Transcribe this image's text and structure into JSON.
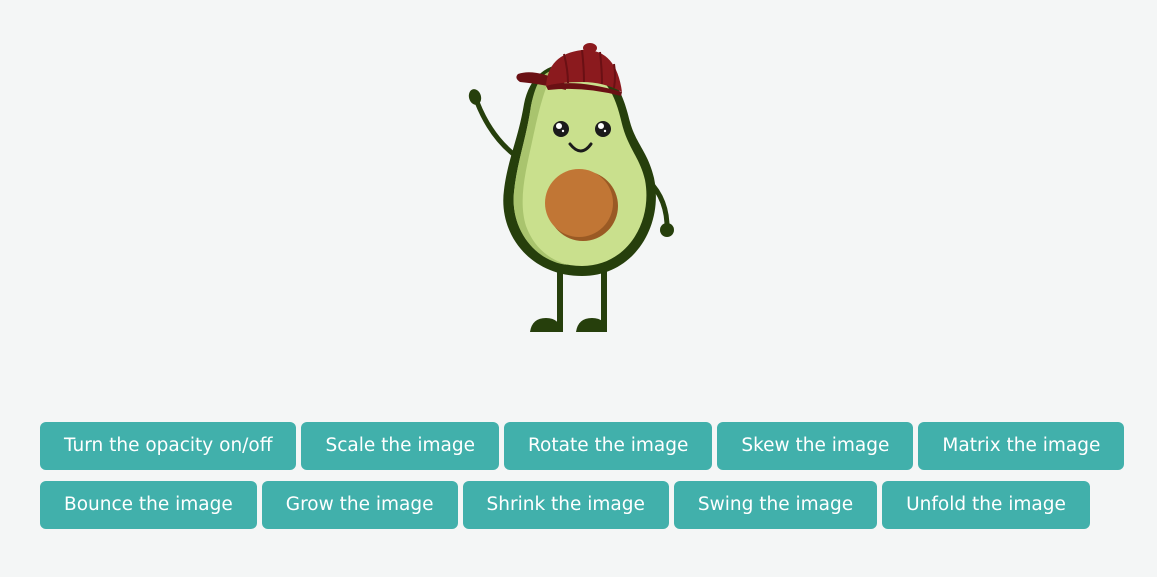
{
  "image": {
    "alt": "Avocado character",
    "colors": {
      "cap": "#8b1a1e",
      "cap_dark": "#6a1014",
      "outline": "#263f0c",
      "flesh": "#c9e08d",
      "flesh_shadow": "#a9c46e",
      "pit": "#c17635",
      "pit_shadow": "#9a5a24"
    }
  },
  "buttons": [
    {
      "label": "Turn the opacity on/off"
    },
    {
      "label": "Scale the image"
    },
    {
      "label": "Rotate the image"
    },
    {
      "label": "Skew the image"
    },
    {
      "label": "Matrix the image"
    },
    {
      "label": "Bounce the image"
    },
    {
      "label": "Grow the image"
    },
    {
      "label": "Shrink the image"
    },
    {
      "label": "Swing the image"
    },
    {
      "label": "Unfold the image"
    }
  ],
  "theme": {
    "background": "#f4f6f6",
    "button_bg": "#41b0ab",
    "button_text": "#ffffff"
  }
}
